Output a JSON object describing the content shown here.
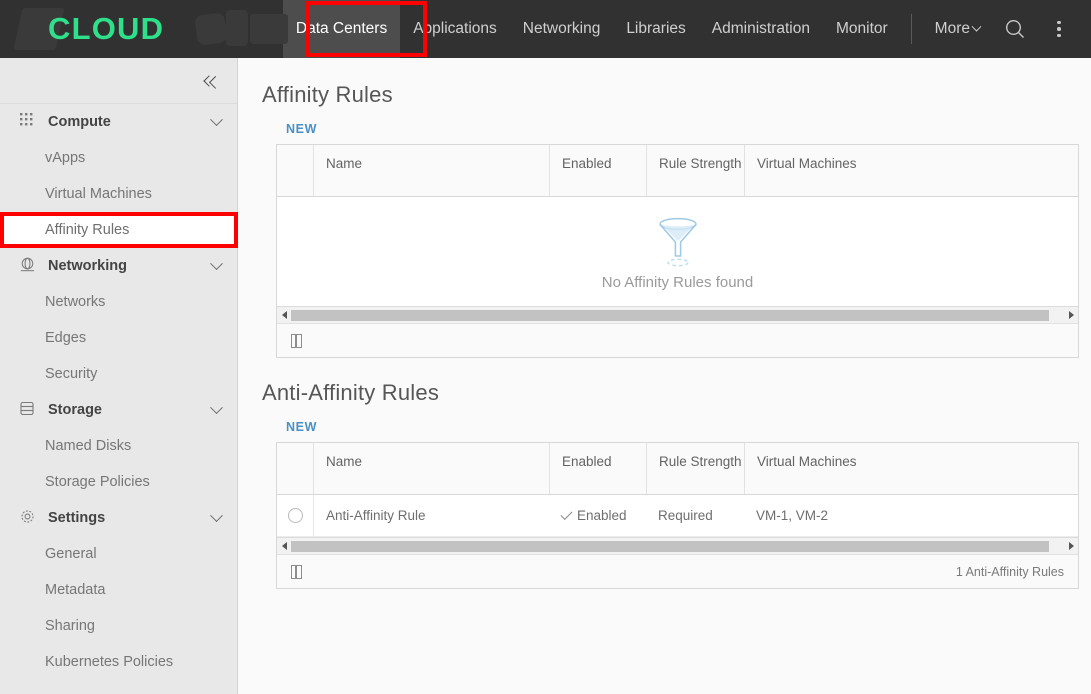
{
  "header": {
    "logo_text": "CLOUD",
    "nav_items": [
      {
        "label": "Data Centers",
        "active": true
      },
      {
        "label": "Applications",
        "active": false
      },
      {
        "label": "Networking",
        "active": false
      },
      {
        "label": "Libraries",
        "active": false
      },
      {
        "label": "Administration",
        "active": false
      },
      {
        "label": "Monitor",
        "active": false
      }
    ],
    "more_label": "More",
    "search_icon": "search-icon",
    "overflow_icon": "kebab-menu-icon"
  },
  "sidebar": {
    "collapse_icon": "double-chevron-left-icon",
    "groups": [
      {
        "label": "Compute",
        "icon": "grid-dots-icon",
        "items": [
          {
            "label": "vApps",
            "selected": false
          },
          {
            "label": "Virtual Machines",
            "selected": false
          },
          {
            "label": "Affinity Rules",
            "selected": true
          }
        ]
      },
      {
        "label": "Networking",
        "icon": "globe-icon",
        "items": [
          {
            "label": "Networks",
            "selected": false
          },
          {
            "label": "Edges",
            "selected": false
          },
          {
            "label": "Security",
            "selected": false
          }
        ]
      },
      {
        "label": "Storage",
        "icon": "database-icon",
        "items": [
          {
            "label": "Named Disks",
            "selected": false
          },
          {
            "label": "Storage Policies",
            "selected": false
          }
        ]
      },
      {
        "label": "Settings",
        "icon": "gear-icon",
        "items": [
          {
            "label": "General",
            "selected": false
          },
          {
            "label": "Metadata",
            "selected": false
          },
          {
            "label": "Sharing",
            "selected": false
          },
          {
            "label": "Kubernetes Policies",
            "selected": false
          }
        ]
      }
    ]
  },
  "affinity": {
    "title": "Affinity Rules",
    "new_label": "NEW",
    "columns": [
      "",
      "Name",
      "Enabled",
      "Rule Strength",
      "Virtual Machines"
    ],
    "empty_text": "No Affinity Rules found",
    "empty_icon": "funnel-icon",
    "rows": [],
    "footer_count": "",
    "columns_icon": "column-settings-icon"
  },
  "anti_affinity": {
    "title": "Anti-Affinity Rules",
    "new_label": "NEW",
    "columns": [
      "",
      "Name",
      "Enabled",
      "Rule Strength",
      "Virtual Machines"
    ],
    "rows": [
      {
        "name": "Anti-Affinity Rule",
        "enabled": "Enabled",
        "strength": "Required",
        "vms": "VM-1, VM-2"
      }
    ],
    "footer_count": "1 Anti-Affinity Rules",
    "columns_icon": "column-settings-icon"
  },
  "colors": {
    "topbar_bg": "#313131",
    "logo_green": "#2fe08a",
    "active_tab_bg": "#4d4d4d",
    "link_blue": "#4a90c4",
    "annotation_red": "#ff0000",
    "sidebar_bg": "#e8e8e8",
    "funnel_blue": "#a8cfe8"
  }
}
